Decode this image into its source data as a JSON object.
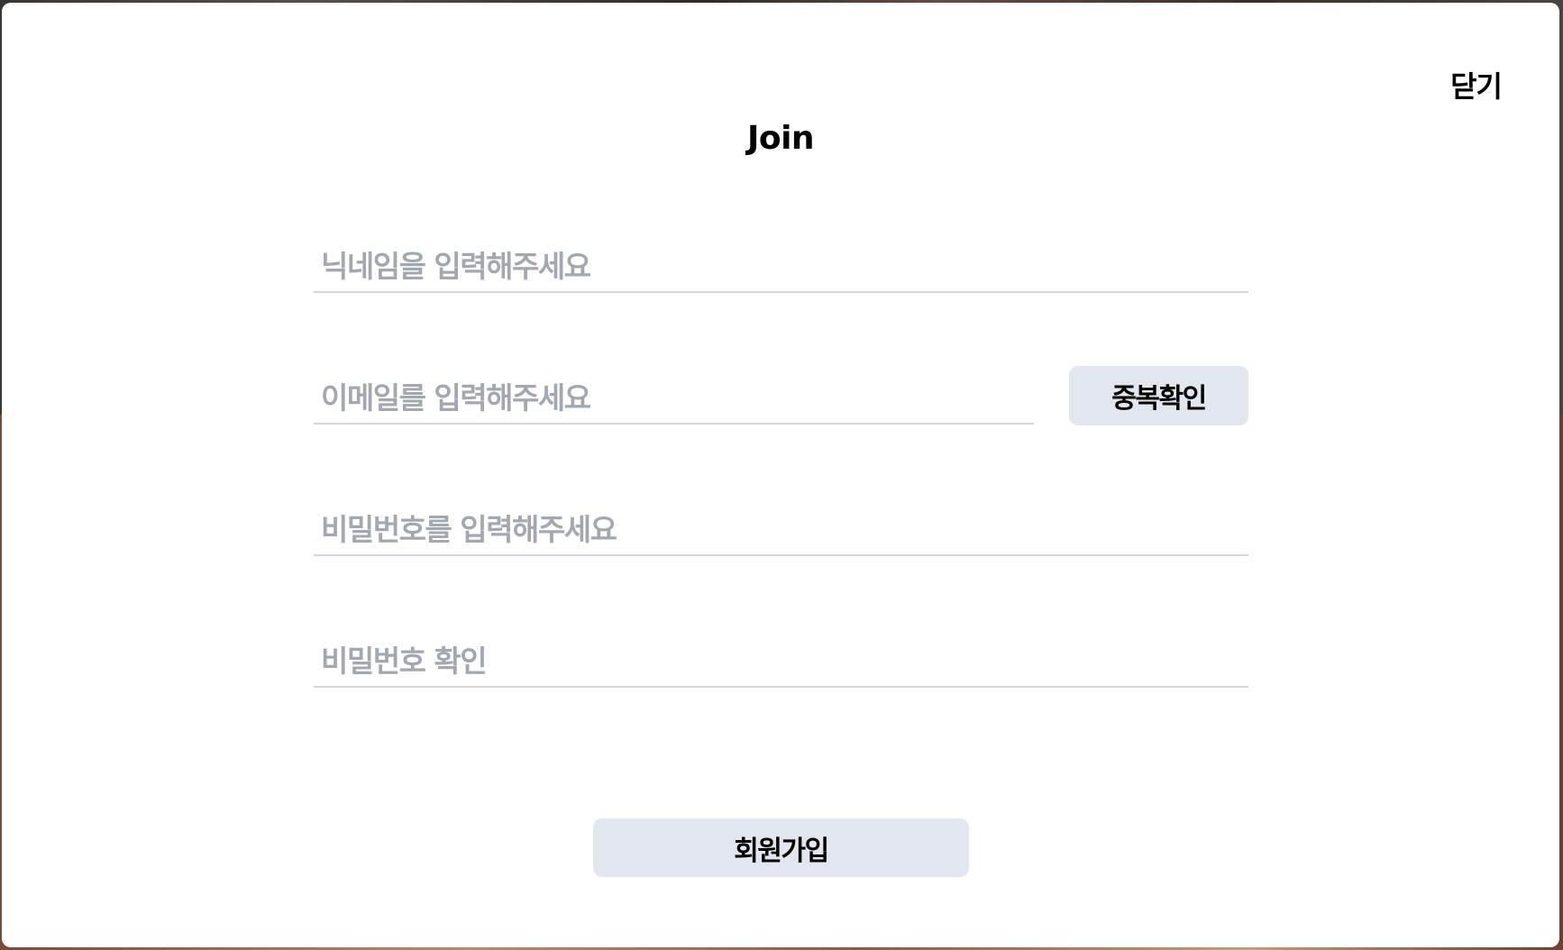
{
  "modal": {
    "close_label": "닫기",
    "title": "Join"
  },
  "form": {
    "nickname_placeholder": "닉네임을 입력해주세요",
    "email_placeholder": "이메일를 입력해주세요",
    "password_placeholder": "비밀번호를 입력해주세요",
    "password_confirm_placeholder": "비밀번호 확인",
    "duplicate_check_label": "중복확인",
    "submit_label": "회원가입"
  },
  "colors": {
    "button_bg": "#e2e6ee",
    "placeholder": "#a3a8b0",
    "underline": "#d3d7dd"
  }
}
